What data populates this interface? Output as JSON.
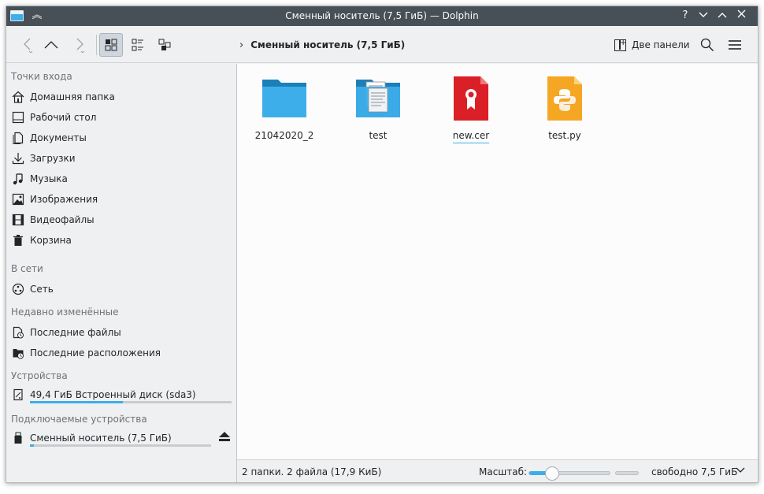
{
  "window": {
    "title": "Сменный носитель (7,5 ГиБ) — Dolphin",
    "buttons": [
      "help",
      "minimize",
      "maximize",
      "close"
    ]
  },
  "toolbar": {
    "breadcrumb": "Сменный носитель (7,5 ГиБ)",
    "split_label": "Две панели",
    "view_modes": [
      "icons",
      "details",
      "compact"
    ],
    "active_view": "icons"
  },
  "places": {
    "sections": [
      {
        "title": "Точки входа",
        "items": [
          {
            "label": "Домашняя папка",
            "icon": "home-icon"
          },
          {
            "label": "Рабочий стол",
            "icon": "desktop-icon"
          },
          {
            "label": "Документы",
            "icon": "documents-icon"
          },
          {
            "label": "Загрузки",
            "icon": "downloads-icon"
          },
          {
            "label": "Музыка",
            "icon": "music-icon"
          },
          {
            "label": "Изображения",
            "icon": "pictures-icon"
          },
          {
            "label": "Видеофайлы",
            "icon": "videos-icon"
          },
          {
            "label": "Корзина",
            "icon": "trash-icon"
          }
        ]
      },
      {
        "title": "В сети",
        "items": [
          {
            "label": "Сеть",
            "icon": "network-icon"
          }
        ]
      },
      {
        "title": "Недавно изменённые",
        "items": [
          {
            "label": "Последние файлы",
            "icon": "recent-files-icon"
          },
          {
            "label": "Последние расположения",
            "icon": "recent-locations-icon"
          }
        ]
      },
      {
        "title": "Устройства",
        "items": [
          {
            "label": "49,4 ГиБ Встроенный диск (sda3)",
            "icon": "drive-icon",
            "usage": 0.46
          }
        ]
      },
      {
        "title": "Подключаемые устройства",
        "items": [
          {
            "label": "Сменный носитель (7,5 ГиБ)",
            "icon": "usb-drive-icon",
            "usage": 0.02
          }
        ]
      }
    ]
  },
  "files": [
    {
      "name": "21042020_2",
      "type": "folder"
    },
    {
      "name": "test",
      "type": "folder-documents"
    },
    {
      "name": "new.cer",
      "type": "certificate"
    },
    {
      "name": "test.py",
      "type": "python"
    }
  ],
  "status": {
    "info": "2 папки. 2 файла (17,9 КиБ)",
    "zoom_label": "Масштаб:",
    "zoom_level": 0.28,
    "free": "свободно 7,5 ГиБ"
  },
  "colors": {
    "accent": "#3daee9",
    "titlebar": "#475057",
    "folder": "#3daee9",
    "cert": "#da1f26",
    "python": "#f5a623"
  }
}
